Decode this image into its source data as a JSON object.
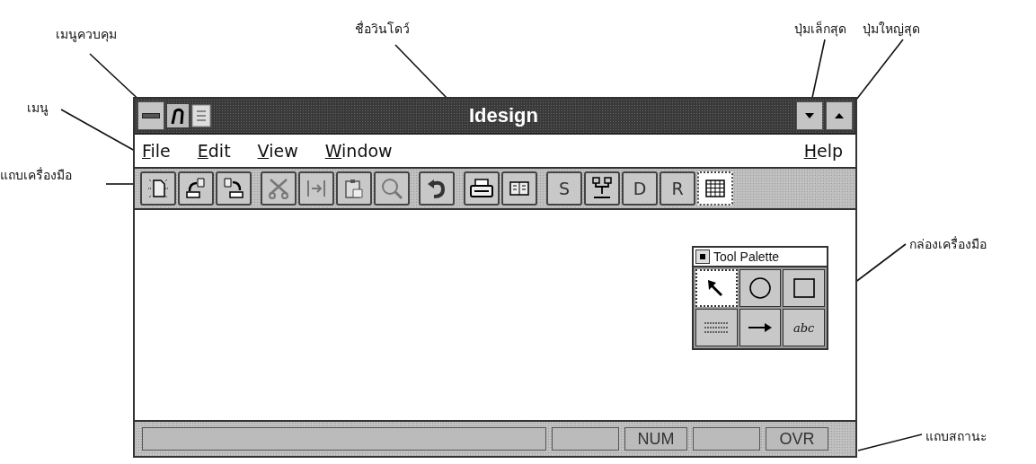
{
  "annotations": [
    {
      "text": "เมนูควบคุม"
    },
    {
      "text": "ชื่อวินโดว์"
    },
    {
      "text": "ปุ่มเล็กสุด"
    },
    {
      "text": "ปุ่มใหญ่สุด"
    },
    {
      "text": "เมนู"
    },
    {
      "text": "แถบเครื่องมือ"
    },
    {
      "text": "กล่องเครื่องมือ"
    },
    {
      "text": "แถบสถานะ"
    }
  ],
  "window": {
    "title": "Idesign"
  },
  "menu": {
    "left": [
      {
        "label": "File"
      },
      {
        "label": "Edit"
      },
      {
        "label": "View"
      },
      {
        "label": "Window"
      }
    ],
    "right": [
      {
        "label": "Help"
      }
    ]
  },
  "toolbar": {
    "groups": [
      [
        {
          "kind": "new",
          "selected": false
        },
        {
          "kind": "open",
          "selected": false
        },
        {
          "kind": "save",
          "selected": false
        }
      ],
      [
        {
          "kind": "cut",
          "selected": false
        },
        {
          "kind": "copy",
          "selected": false
        },
        {
          "kind": "paste",
          "selected": false
        },
        {
          "kind": "zoom",
          "selected": false
        }
      ],
      [
        {
          "kind": "undo",
          "selected": false
        }
      ],
      [
        {
          "kind": "print",
          "selected": false
        },
        {
          "kind": "preview",
          "selected": false
        }
      ],
      [
        {
          "kind": "letter",
          "label": "S",
          "selected": false
        },
        {
          "kind": "tree",
          "selected": false
        },
        {
          "kind": "letter",
          "label": "D",
          "selected": false
        },
        {
          "kind": "letter",
          "label": "R",
          "selected": false
        },
        {
          "kind": "grid",
          "selected": true
        }
      ]
    ]
  },
  "tool_palette": {
    "title": "Tool Palette",
    "tools": [
      {
        "kind": "pointer",
        "selected": true
      },
      {
        "kind": "ellipse",
        "selected": false
      },
      {
        "kind": "rectangle",
        "selected": false
      },
      {
        "kind": "lines",
        "selected": false
      },
      {
        "kind": "arrow",
        "selected": false
      },
      {
        "kind": "text",
        "label": "abc",
        "selected": false
      }
    ]
  },
  "status_bar": {
    "panels": [
      {
        "kind": "wide"
      },
      {
        "kind": "blank"
      },
      {
        "kind": "text",
        "text": "NUM"
      },
      {
        "kind": "blank"
      },
      {
        "kind": "text",
        "text": "OVR"
      }
    ]
  }
}
